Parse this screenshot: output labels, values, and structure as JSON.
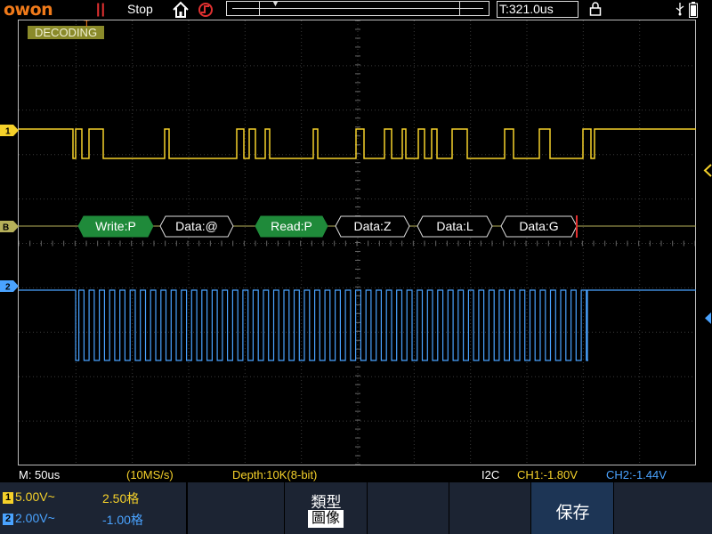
{
  "header": {
    "logo": "owon",
    "run_icon": "||",
    "run_status": "Stop",
    "trigger_time": "T:321.0us"
  },
  "screen": {
    "decoding_label": "DECODING",
    "trigger_marker": "T",
    "ch1_marker": "1",
    "bus_marker": "B",
    "ch2_marker": "2",
    "decode_frames": [
      {
        "label": "Write:P",
        "type": "address"
      },
      {
        "label": "Data:@",
        "type": "data"
      },
      {
        "label": "Read:P",
        "type": "address"
      },
      {
        "label": "Data:Z",
        "type": "data"
      },
      {
        "label": "Data:L",
        "type": "data"
      },
      {
        "label": "Data:G",
        "type": "data"
      }
    ]
  },
  "status_bar": {
    "timebase": "M: 50us",
    "sample_rate": "(10MS/s)",
    "depth": "Depth:10K(8-bit)",
    "protocol": "I2C",
    "ch1_trigger": "CH1:-1.80V",
    "ch2_trigger": "CH2:-1.44V"
  },
  "softkeys": {
    "ch1_badge": "1",
    "ch1_volts": "5.00V~",
    "ch1_offset": "2.50格",
    "ch2_badge": "2",
    "ch2_volts": "2.00V~",
    "ch2_offset": "-1.00格",
    "type_label": "類型",
    "type_value": "圖像",
    "save_label": "保存"
  },
  "colors": {
    "ch1": "#f5d12a",
    "ch2": "#4aa3ff",
    "bus": "#b6b05a",
    "address_frame": "#1f8a3a",
    "brand": "#f07a1a",
    "softkey_bg": "#1c2433",
    "save_key_bg": "#1d3555"
  }
}
